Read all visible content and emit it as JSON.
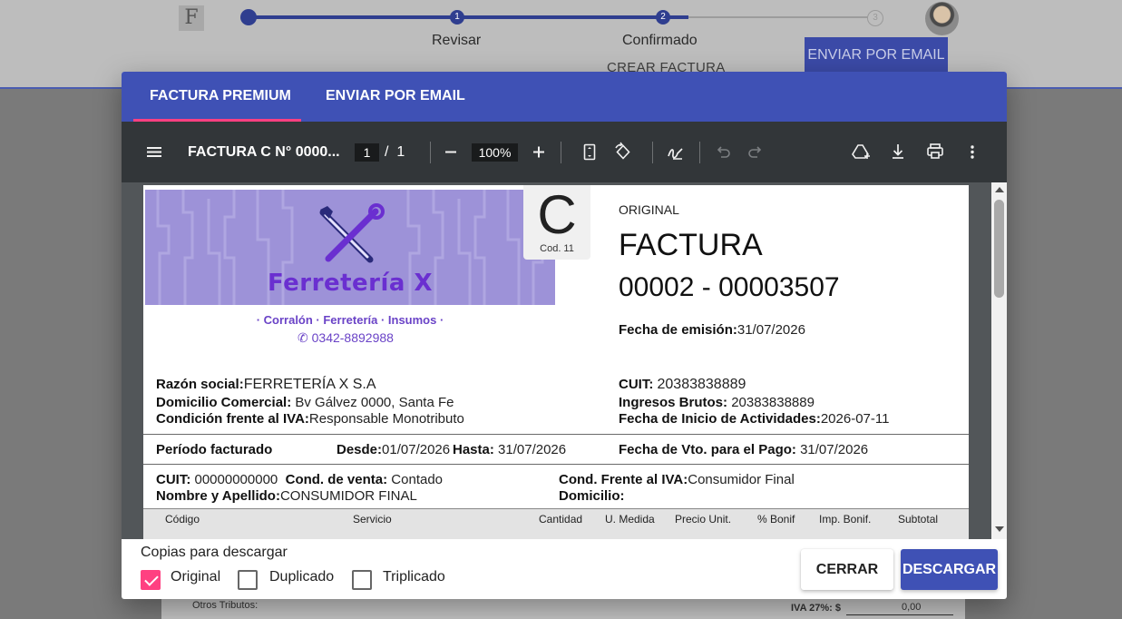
{
  "app": {
    "logo_letter": "F",
    "avatar": "user-avatar"
  },
  "stepper": {
    "steps": [
      {
        "number": "",
        "label": ""
      },
      {
        "number": "1",
        "label": "Revisar"
      },
      {
        "number": "2",
        "label": "Confirmado"
      },
      {
        "number": "3",
        "label": ""
      }
    ],
    "subtitle": "CREAR FACTURA",
    "email_button": "ENVIAR POR EMAIL"
  },
  "background_doc": {
    "otros_tributos": "Otros Tributos:",
    "iva_27": "IVA 27%: $",
    "iva_27_value": "0,00"
  },
  "dialog": {
    "tabs": [
      {
        "label": "FACTURA PREMIUM",
        "active": true
      },
      {
        "label": "ENVIAR POR EMAIL",
        "active": false
      }
    ]
  },
  "pdf_viewer": {
    "title": "FACTURA C N° 0000...",
    "current_page": "1",
    "page_separator": "/",
    "total_pages": "1",
    "zoom": "100%",
    "icons": [
      "menu-icon",
      "zoom-out-icon",
      "zoom-in-icon",
      "fit-page-icon",
      "rotate-icon",
      "annotate-icon",
      "undo-icon",
      "redo-icon",
      "save-to-drive-icon",
      "download-icon",
      "print-icon",
      "more-options-icon"
    ]
  },
  "invoice": {
    "brand": {
      "name": "Ferretería X",
      "tagline": "· Corralón · Ferretería · Insumos ·",
      "phone": "0342-8892988"
    },
    "letter": "C",
    "cod": "Cod. 11",
    "copy": "ORIGINAL",
    "doc_type": "FACTURA",
    "number": "00002 - 00003507",
    "fecha_emision_label": "Fecha de emisión:",
    "fecha_emision": "31/07/2026",
    "razon_social_label": "Razón social:",
    "razon_social": "FERRETERÍA X S.A",
    "domicilio_label": "Domicilio Comercial:",
    "domicilio": "Bv Gálvez 0000, Santa Fe",
    "condicion_iva_label": "Condición frente al IVA:",
    "condicion_iva": "Responsable Monotributo",
    "cuit_label": "CUIT:",
    "cuit": "20383838889",
    "ingresos_brutos_label": "Ingresos Brutos:",
    "ingresos_brutos": "20383838889",
    "inicio_actividades_label": "Fecha de Inicio de Actividades:",
    "inicio_actividades": "2026-07-11",
    "periodo_label": "Período facturado",
    "desde_label": "Desde:",
    "desde": "01/07/2026",
    "hasta_label": "Hasta:",
    "hasta": "31/07/2026",
    "vto_label": "Fecha de Vto. para el Pago:",
    "vto": "31/07/2026",
    "cliente_cuit_label": "CUIT:",
    "cliente_cuit": "00000000000",
    "cond_venta_label": "Cond. de venta:",
    "cond_venta": "Contado",
    "cond_iva_cliente_label": "Cond. Frente al IVA:",
    "cond_iva_cliente": "Consumidor Final",
    "nombre_label": "Nombre y Apellido:",
    "nombre": "CONSUMIDOR FINAL",
    "domicilio_cliente_label": "Domicilio:",
    "columns": [
      "Código",
      "Servicio",
      "Cantidad",
      "U. Medida",
      "Precio Unit.",
      "% Bonif",
      "Imp. Bonif.",
      "Subtotal"
    ]
  },
  "footer": {
    "label": "Copias para descargar",
    "copies": [
      {
        "label": "Original",
        "checked": true
      },
      {
        "label": "Duplicado",
        "checked": false
      },
      {
        "label": "Triplicado",
        "checked": false
      }
    ],
    "close_button": "CERRAR",
    "download_button": "DESCARGAR"
  },
  "colors": {
    "primary": "#3f51b5",
    "accent": "#ff4081",
    "viewer_toolbar": "#323639",
    "brand_purple": "#6a2fd0"
  }
}
